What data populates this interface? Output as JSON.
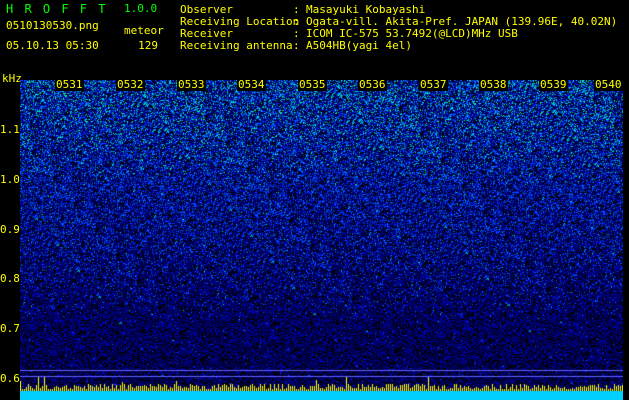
{
  "app": {
    "name": "H R O F F T",
    "version": "1.0.0"
  },
  "file": {
    "name": "0510130530.png",
    "capture_type": "meteor",
    "datetime": "05.10.13 05:30",
    "count": "129"
  },
  "info": [
    {
      "label": "Observer",
      "value": "Masayuki Kobayashi"
    },
    {
      "label": "Receiving Location",
      "value": "Ogata-vill. Akita-Pref. JAPAN (139.96E, 40.02N)"
    },
    {
      "label": "Receiver",
      "value": "ICOM IC-575 53.7492(@LCD)MHz USB"
    },
    {
      "label": "Receiving antenna",
      "value": "A504HB(yagi 4el)"
    }
  ],
  "separator": ":",
  "spectrogram": {
    "y_unit": "kHz",
    "y_ticks": [
      "1.1",
      "1.0",
      "0.9",
      "0.8",
      "0.7",
      "0.6"
    ],
    "x_ticks": [
      "0531",
      "0532",
      "0533",
      "0534",
      "0535",
      "0536",
      "0537",
      "0538",
      "0539",
      "0540"
    ],
    "colors": {
      "background": "#000010",
      "low": "#0000a0",
      "mid": "#0050ff",
      "high": "#00e0c0",
      "peak": "#ffff00",
      "baseline": "#00d0ff"
    }
  }
}
